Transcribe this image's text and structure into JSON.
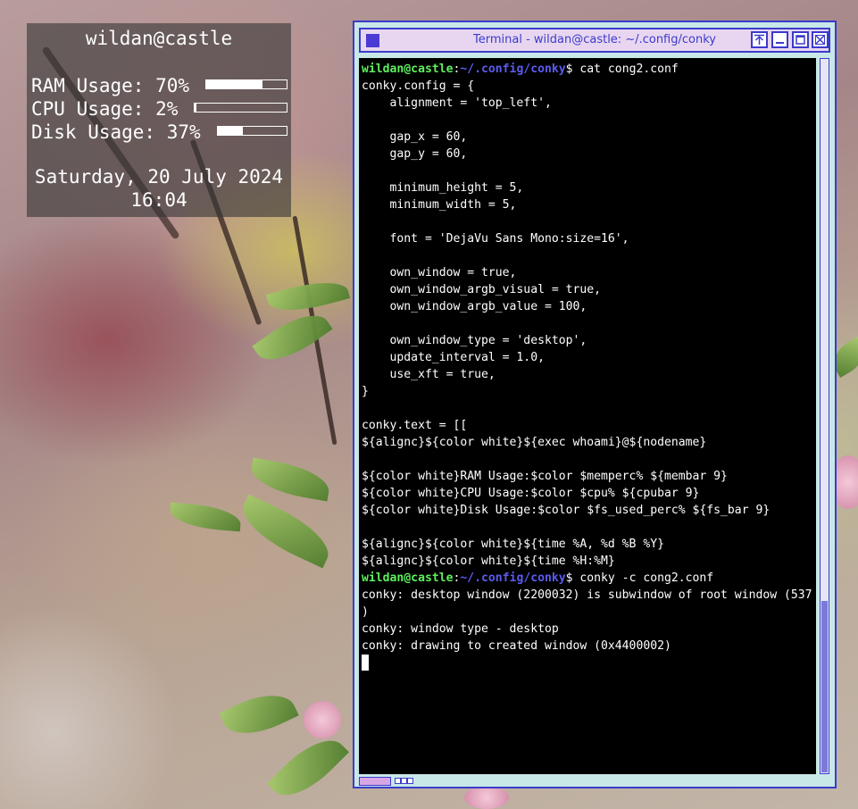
{
  "conky": {
    "header": "wildan@castle",
    "rows": [
      {
        "label": "RAM Usage: 70%",
        "percent": 70
      },
      {
        "label": "CPU Usage: 2%",
        "percent": 2
      },
      {
        "label": "Disk Usage: 37%",
        "percent": 37
      }
    ],
    "date": "Saturday, 20 July 2024",
    "time": "16:04"
  },
  "terminal": {
    "title": "Terminal - wildan@castle: ~/.config/conky",
    "user_host": "wildan@castle",
    "prompt_path": "~/.config/conky",
    "lines": [
      {
        "type": "prompt",
        "cmd": "$ cat cong2.conf"
      },
      {
        "type": "text",
        "text": "conky.config = {"
      },
      {
        "type": "text",
        "text": "    alignment = 'top_left',"
      },
      {
        "type": "text",
        "text": ""
      },
      {
        "type": "text",
        "text": "    gap_x = 60,"
      },
      {
        "type": "text",
        "text": "    gap_y = 60,"
      },
      {
        "type": "text",
        "text": ""
      },
      {
        "type": "text",
        "text": "    minimum_height = 5,"
      },
      {
        "type": "text",
        "text": "    minimum_width = 5,"
      },
      {
        "type": "text",
        "text": ""
      },
      {
        "type": "text",
        "text": "    font = 'DejaVu Sans Mono:size=16',"
      },
      {
        "type": "text",
        "text": ""
      },
      {
        "type": "text",
        "text": "    own_window = true,"
      },
      {
        "type": "text",
        "text": "    own_window_argb_visual = true,"
      },
      {
        "type": "text",
        "text": "    own_window_argb_value = 100,"
      },
      {
        "type": "text",
        "text": ""
      },
      {
        "type": "text",
        "text": "    own_window_type = 'desktop',"
      },
      {
        "type": "text",
        "text": "    update_interval = 1.0,"
      },
      {
        "type": "text",
        "text": "    use_xft = true,"
      },
      {
        "type": "text",
        "text": "}"
      },
      {
        "type": "text",
        "text": ""
      },
      {
        "type": "text",
        "text": "conky.text = [["
      },
      {
        "type": "text",
        "text": "${alignc}${color white}${exec whoami}@${nodename}"
      },
      {
        "type": "text",
        "text": ""
      },
      {
        "type": "text",
        "text": "${color white}RAM Usage:$color $memperc% ${membar 9}"
      },
      {
        "type": "text",
        "text": "${color white}CPU Usage:$color $cpu% ${cpubar 9}"
      },
      {
        "type": "text",
        "text": "${color white}Disk Usage:$color $fs_used_perc% ${fs_bar 9}"
      },
      {
        "type": "text",
        "text": ""
      },
      {
        "type": "text",
        "text": "${alignc}${color white}${time %A, %d %B %Y}"
      },
      {
        "type": "text",
        "text": "${alignc}${color white}${time %H:%M}"
      },
      {
        "type": "prompt",
        "cmd": "$ conky -c cong2.conf"
      },
      {
        "type": "text",
        "text": "conky: desktop window (2200032) is subwindow of root window (537"
      },
      {
        "type": "text",
        "text": ")"
      },
      {
        "type": "text",
        "text": "conky: window type - desktop"
      },
      {
        "type": "text",
        "text": "conky: drawing to created window (0x4400002)"
      },
      {
        "type": "cursor"
      }
    ]
  },
  "colors": {
    "prompt_user": "#5ef05e",
    "prompt_path": "#5b5bf0",
    "window_border": "#3b3bcb",
    "titlebar": "#e8d6f0"
  }
}
